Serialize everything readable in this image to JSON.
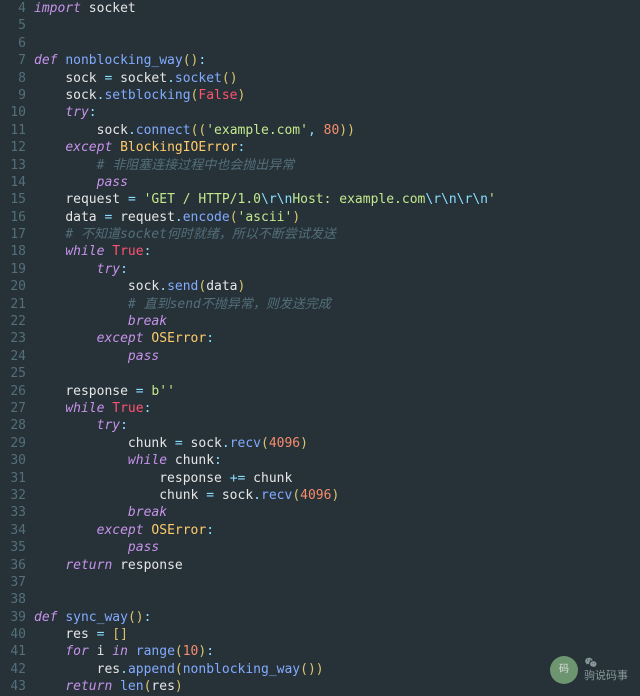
{
  "line_start": 4,
  "lines": [
    [
      [
        "kw",
        "import"
      ],
      [
        "",
        ""
      ],
      [
        "mod",
        " socket"
      ]
    ],
    [],
    [],
    [
      [
        "kw",
        "def"
      ],
      [
        "",
        " "
      ],
      [
        "fn",
        "nonblocking_way"
      ],
      [
        "pun",
        "()"
      ],
      [
        "op",
        ":"
      ]
    ],
    [
      [
        "",
        "    "
      ],
      [
        "var",
        "sock "
      ],
      [
        "op",
        "="
      ],
      [
        "",
        " "
      ],
      [
        "var",
        "socket"
      ],
      [
        "op",
        "."
      ],
      [
        "call",
        "socket"
      ],
      [
        "pun",
        "()"
      ]
    ],
    [
      [
        "",
        "    "
      ],
      [
        "var",
        "sock"
      ],
      [
        "op",
        "."
      ],
      [
        "call",
        "setblocking"
      ],
      [
        "pun",
        "("
      ],
      [
        "bool",
        "False"
      ],
      [
        "pun",
        ")"
      ]
    ],
    [
      [
        "",
        "    "
      ],
      [
        "kw",
        "try"
      ],
      [
        "op",
        ":"
      ]
    ],
    [
      [
        "",
        "        "
      ],
      [
        "var",
        "sock"
      ],
      [
        "op",
        "."
      ],
      [
        "call",
        "connect"
      ],
      [
        "pun",
        "(("
      ],
      [
        "str",
        "'example.com'"
      ],
      [
        "op",
        ","
      ],
      [
        "",
        " "
      ],
      [
        "num",
        "80"
      ],
      [
        "pun",
        "))"
      ]
    ],
    [
      [
        "",
        "    "
      ],
      [
        "kw",
        "except"
      ],
      [
        "",
        " "
      ],
      [
        "cls",
        "BlockingIOError"
      ],
      [
        "op",
        ":"
      ]
    ],
    [
      [
        "",
        "        "
      ],
      [
        "cmt",
        "# 非阻塞连接过程中也会抛出异常"
      ]
    ],
    [
      [
        "",
        "        "
      ],
      [
        "kw",
        "pass"
      ]
    ],
    [
      [
        "",
        "    "
      ],
      [
        "var",
        "request "
      ],
      [
        "op",
        "="
      ],
      [
        "",
        " "
      ],
      [
        "str",
        "'GET / HTTP/1.0"
      ],
      [
        "esc",
        "\\r\\n"
      ],
      [
        "str",
        "Host: example.com"
      ],
      [
        "esc",
        "\\r\\n\\r\\n"
      ],
      [
        "str",
        "'"
      ]
    ],
    [
      [
        "",
        "    "
      ],
      [
        "var",
        "data "
      ],
      [
        "op",
        "="
      ],
      [
        "",
        " "
      ],
      [
        "var",
        "request"
      ],
      [
        "op",
        "."
      ],
      [
        "call",
        "encode"
      ],
      [
        "pun",
        "("
      ],
      [
        "str",
        "'ascii'"
      ],
      [
        "pun",
        ")"
      ]
    ],
    [
      [
        "",
        "    "
      ],
      [
        "cmt",
        "# 不知道socket何时就绪，所以不断尝试发送"
      ]
    ],
    [
      [
        "",
        "    "
      ],
      [
        "kw",
        "while"
      ],
      [
        "",
        " "
      ],
      [
        "bool",
        "True"
      ],
      [
        "op",
        ":"
      ]
    ],
    [
      [
        "",
        "        "
      ],
      [
        "kw",
        "try"
      ],
      [
        "op",
        ":"
      ]
    ],
    [
      [
        "",
        "            "
      ],
      [
        "var",
        "sock"
      ],
      [
        "op",
        "."
      ],
      [
        "call",
        "send"
      ],
      [
        "pun",
        "("
      ],
      [
        "var",
        "data"
      ],
      [
        "pun",
        ")"
      ]
    ],
    [
      [
        "",
        "            "
      ],
      [
        "cmt",
        "# 直到send不抛异常，则发送完成"
      ]
    ],
    [
      [
        "",
        "            "
      ],
      [
        "kw",
        "break"
      ]
    ],
    [
      [
        "",
        "        "
      ],
      [
        "kw",
        "except"
      ],
      [
        "",
        " "
      ],
      [
        "cls",
        "OSError"
      ],
      [
        "op",
        ":"
      ]
    ],
    [
      [
        "",
        "            "
      ],
      [
        "kw",
        "pass"
      ]
    ],
    [],
    [
      [
        "",
        "    "
      ],
      [
        "var",
        "response "
      ],
      [
        "op",
        "="
      ],
      [
        "",
        " "
      ],
      [
        "byte",
        "b''"
      ]
    ],
    [
      [
        "",
        "    "
      ],
      [
        "kw",
        "while"
      ],
      [
        "",
        " "
      ],
      [
        "bool",
        "True"
      ],
      [
        "op",
        ":"
      ]
    ],
    [
      [
        "",
        "        "
      ],
      [
        "kw",
        "try"
      ],
      [
        "op",
        ":"
      ]
    ],
    [
      [
        "",
        "            "
      ],
      [
        "var",
        "chunk "
      ],
      [
        "op",
        "="
      ],
      [
        "",
        " "
      ],
      [
        "var",
        "sock"
      ],
      [
        "op",
        "."
      ],
      [
        "call",
        "recv"
      ],
      [
        "pun",
        "("
      ],
      [
        "num",
        "4096"
      ],
      [
        "pun",
        ")"
      ]
    ],
    [
      [
        "",
        "            "
      ],
      [
        "kw",
        "while"
      ],
      [
        "",
        " "
      ],
      [
        "var",
        "chunk"
      ],
      [
        "op",
        ":"
      ]
    ],
    [
      [
        "",
        "                "
      ],
      [
        "var",
        "response "
      ],
      [
        "op",
        "+="
      ],
      [
        "",
        " "
      ],
      [
        "var",
        "chunk"
      ]
    ],
    [
      [
        "",
        "                "
      ],
      [
        "var",
        "chunk "
      ],
      [
        "op",
        "="
      ],
      [
        "",
        " "
      ],
      [
        "var",
        "sock"
      ],
      [
        "op",
        "."
      ],
      [
        "call",
        "recv"
      ],
      [
        "pun",
        "("
      ],
      [
        "num",
        "4096"
      ],
      [
        "pun",
        ")"
      ]
    ],
    [
      [
        "",
        "            "
      ],
      [
        "kw",
        "break"
      ]
    ],
    [
      [
        "",
        "        "
      ],
      [
        "kw",
        "except"
      ],
      [
        "",
        " "
      ],
      [
        "cls",
        "OSError"
      ],
      [
        "op",
        ":"
      ]
    ],
    [
      [
        "",
        "            "
      ],
      [
        "kw",
        "pass"
      ]
    ],
    [
      [
        "",
        "    "
      ],
      [
        "kw",
        "return"
      ],
      [
        "",
        " "
      ],
      [
        "var",
        "response"
      ]
    ],
    [],
    [],
    [
      [
        "kw",
        "def"
      ],
      [
        "",
        " "
      ],
      [
        "fn",
        "sync_way"
      ],
      [
        "pun",
        "()"
      ],
      [
        "op",
        ":"
      ]
    ],
    [
      [
        "",
        "    "
      ],
      [
        "var",
        "res "
      ],
      [
        "op",
        "="
      ],
      [
        "",
        " "
      ],
      [
        "pun",
        "[]"
      ]
    ],
    [
      [
        "",
        "    "
      ],
      [
        "kw",
        "for"
      ],
      [
        "",
        " "
      ],
      [
        "var",
        "i"
      ],
      [
        "",
        " "
      ],
      [
        "kw",
        "in"
      ],
      [
        "",
        " "
      ],
      [
        "call",
        "range"
      ],
      [
        "pun",
        "("
      ],
      [
        "num",
        "10"
      ],
      [
        "pun",
        ")"
      ],
      [
        "op",
        ":"
      ]
    ],
    [
      [
        "",
        "        "
      ],
      [
        "var",
        "res"
      ],
      [
        "op",
        "."
      ],
      [
        "call",
        "append"
      ],
      [
        "pun",
        "("
      ],
      [
        "call",
        "nonblocking_way"
      ],
      [
        "pun",
        "())"
      ]
    ],
    [
      [
        "",
        "    "
      ],
      [
        "kw",
        "return"
      ],
      [
        "",
        " "
      ],
      [
        "call",
        "len"
      ],
      [
        "pun",
        "("
      ],
      [
        "var",
        "res"
      ],
      [
        "pun",
        ")"
      ]
    ]
  ],
  "watermark": {
    "avatar_text": "码",
    "name": "驹说码事"
  }
}
